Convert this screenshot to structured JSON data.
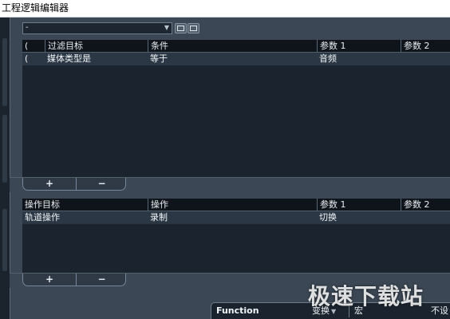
{
  "window": {
    "title": "工程逻辑编辑器"
  },
  "preset": {
    "value": "-"
  },
  "filter_table": {
    "headers": [
      "(",
      "过滤目标",
      "条件",
      "参数 1",
      "参数 2"
    ],
    "rows": [
      {
        "paren": "(",
        "target": "媒体类型是",
        "condition": "等于",
        "param1": "音频",
        "param2": ""
      }
    ]
  },
  "action_table": {
    "headers": [
      "操作目标",
      "操作",
      "参数 1",
      "参数 2"
    ],
    "rows": [
      {
        "target": "轨道操作",
        "operation": "录制",
        "param1": "切换",
        "param2": ""
      }
    ]
  },
  "buttons": {
    "add": "+",
    "remove": "−"
  },
  "footer": {
    "function_label": "Function",
    "mode_value": "变换",
    "macro_label": "宏",
    "extra_label": "不设"
  },
  "watermark": {
    "text": "极速下载站"
  }
}
